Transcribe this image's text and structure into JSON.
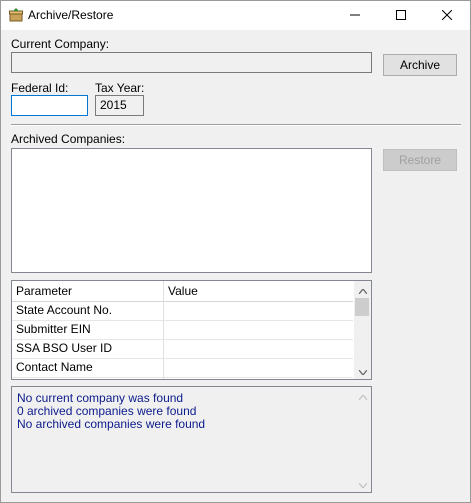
{
  "window": {
    "title": "Archive/Restore",
    "icon": "archive-box-icon",
    "controls": [
      "minimize-icon",
      "maximize-icon",
      "close-icon"
    ]
  },
  "form": {
    "current_company_label": "Current Company:",
    "current_company_value": "",
    "archive_button": "Archive",
    "federal_id_label": "Federal Id:",
    "federal_id_value": "",
    "tax_year_label": "Tax Year:",
    "tax_year_value": "2015",
    "archived_companies_label": "Archived Companies:",
    "restore_button": "Restore"
  },
  "grid": {
    "columns": [
      "Parameter",
      "Value"
    ],
    "rows": [
      {
        "parameter": "State Account No.",
        "value": ""
      },
      {
        "parameter": "Submitter EIN",
        "value": ""
      },
      {
        "parameter": "SSA BSO User ID",
        "value": ""
      },
      {
        "parameter": "Contact Name",
        "value": ""
      }
    ]
  },
  "log": {
    "lines": [
      "No current company was found",
      "0 archived companies were found",
      "No archived companies were found"
    ]
  },
  "colors": {
    "log_text": "#0c1b8c",
    "focus_border": "#0078d7"
  }
}
